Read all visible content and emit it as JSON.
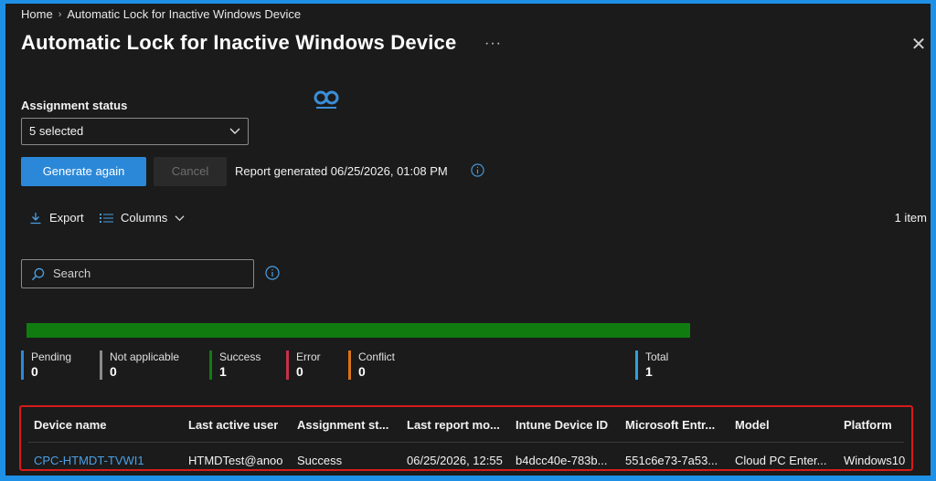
{
  "breadcrumb": {
    "home": "Home",
    "current": "Automatic Lock for Inactive Windows Device"
  },
  "page": {
    "title": "Automatic Lock for Inactive Windows Device",
    "more": "···",
    "close": "✕"
  },
  "filters": {
    "assignment_label": "Assignment status",
    "assignment_value": "5 selected"
  },
  "actions": {
    "generate_again": "Generate again",
    "cancel": "Cancel",
    "report_generated": "Report generated 06/25/2026, 01:08 PM"
  },
  "toolbar": {
    "export": "Export",
    "columns": "Columns",
    "item_count": "1 item"
  },
  "search": {
    "placeholder": "Search"
  },
  "progress": {
    "success_fraction": 1.0,
    "color": "#107c10"
  },
  "stats": [
    {
      "label": "Pending",
      "value": "0",
      "color": "#2b88d8"
    },
    {
      "label": "Not applicable",
      "value": "0",
      "color": "#8a8a8a"
    },
    {
      "label": "Success",
      "value": "1",
      "color": "#107c10"
    },
    {
      "label": "Error",
      "value": "0",
      "color": "#c4314b"
    },
    {
      "label": "Conflict",
      "value": "0",
      "color": "#d9731a"
    },
    {
      "label": "Total",
      "value": "1",
      "color": "#2ea0dd"
    }
  ],
  "table": {
    "columns": [
      "Device name",
      "Last active user",
      "Assignment st...",
      "Last report mo...",
      "Intune Device ID",
      "Microsoft Entr...",
      "Model",
      "Platform"
    ],
    "rows": [
      [
        "CPC-HTMDT-TVWI1",
        "HTMDTest@anoo",
        "Success",
        "06/25/2026, 12:55",
        "b4dcc40e-783b...",
        "551c6e73-7a53...",
        "Cloud PC Enter...",
        "Windows10"
      ]
    ]
  },
  "colors": {
    "accent": "#2b88d8",
    "highlight_border": "#d71a1a",
    "link": "#4aa0e6"
  }
}
